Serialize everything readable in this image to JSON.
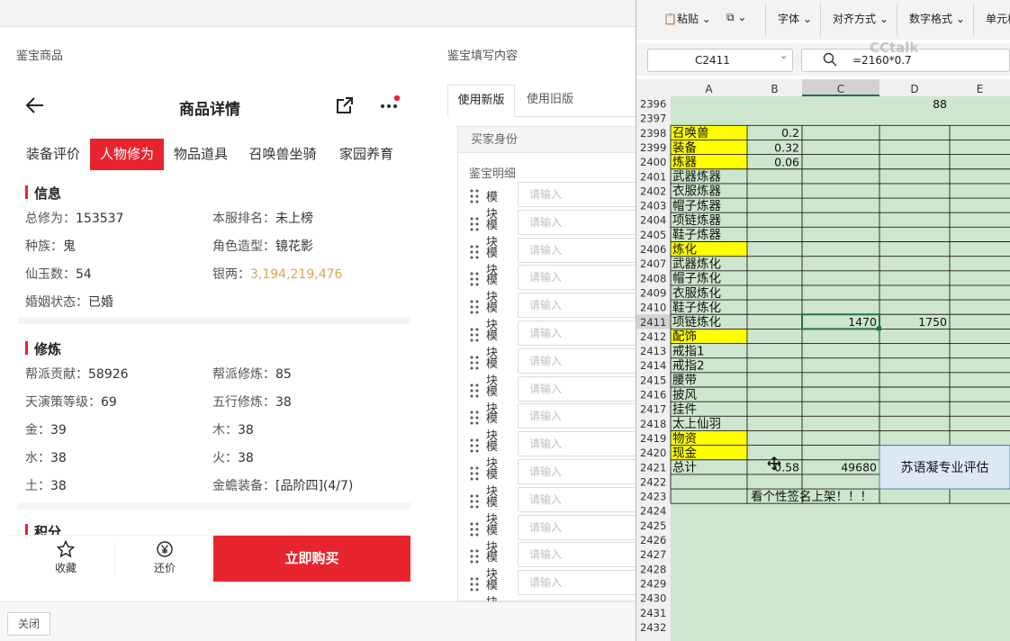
{
  "left_title": "鉴宝商品",
  "right_title": "鉴宝填写内容",
  "close_label": "关闭",
  "phone": {
    "title": "商品详情",
    "tabs": [
      "装备评价",
      "人物修为",
      "物品道具",
      "召唤兽坐骑",
      "家园养育"
    ],
    "active_tab": 1,
    "sections": {
      "info": {
        "title": "信息",
        "rows": [
          [
            {
              "k": "总修为：",
              "v": "153537"
            },
            {
              "k": "本服排名：",
              "v": "未上榜"
            }
          ],
          [
            {
              "k": "种族：",
              "v": "鬼"
            },
            {
              "k": "角色造型：",
              "v": "镜花影"
            }
          ],
          [
            {
              "k": "仙玉数：",
              "v": "54"
            },
            {
              "k": "银两：",
              "v": "3,194,219,476",
              "gold": true
            }
          ],
          [
            {
              "k": "婚姻状态：",
              "v": "已婚"
            }
          ]
        ]
      },
      "train": {
        "title": "修炼",
        "rows": [
          [
            {
              "k": "帮派贡献：",
              "v": "58926"
            },
            {
              "k": "帮派修炼：",
              "v": "85"
            }
          ],
          [
            {
              "k": "天演策等级：",
              "v": "69"
            },
            {
              "k": "五行修炼：",
              "v": "38"
            }
          ],
          [
            {
              "k": "金：",
              "v": "39"
            },
            {
              "k": "木：",
              "v": "38"
            }
          ],
          [
            {
              "k": "水：",
              "v": "38"
            },
            {
              "k": "火：",
              "v": "38"
            }
          ],
          [
            {
              "k": "土：",
              "v": "38"
            },
            {
              "k": "金蟾装备：",
              "v": "[品阶四](4/7)"
            }
          ]
        ]
      },
      "points": {
        "title": "积分"
      }
    },
    "actions": {
      "fav": "收藏",
      "bargain": "还价",
      "buy": "立即购买"
    }
  },
  "form": {
    "tabs": [
      "使用新版",
      "使用旧版"
    ],
    "active_tab": 0,
    "buyer_label": "买家身份",
    "detail_label": "鉴宝明细",
    "row_label": "模块",
    "placeholder": "请输入",
    "row_count": 15
  },
  "excel": {
    "ribbon": {
      "paste": "粘贴",
      "font": "字体",
      "align": "对齐方式",
      "numfmt": "数字格式",
      "cell": "单元格"
    },
    "name_box": "C2411",
    "formula": "=2160*0.7",
    "watermark": "CCtalk",
    "columns": [
      "A",
      "B",
      "C",
      "D",
      "E"
    ],
    "selected_column": "C",
    "selected_row": 2411,
    "rows": [
      {
        "n": 2396,
        "d": "88"
      },
      {
        "n": 2397
      },
      {
        "n": 2398,
        "a": "召唤兽",
        "b": "0.2",
        "hl": true
      },
      {
        "n": 2399,
        "a": "装备",
        "b": "0.32",
        "hl": true
      },
      {
        "n": 2400,
        "a": "炼器",
        "b": "0.06",
        "hl": true
      },
      {
        "n": 2401,
        "a": "武器炼器"
      },
      {
        "n": 2402,
        "a": "衣服炼器"
      },
      {
        "n": 2403,
        "a": "帽子炼器"
      },
      {
        "n": 2404,
        "a": "项链炼器"
      },
      {
        "n": 2405,
        "a": "鞋子炼器"
      },
      {
        "n": 2406,
        "a": "炼化",
        "hl": true
      },
      {
        "n": 2407,
        "a": "武器炼化"
      },
      {
        "n": 2408,
        "a": "帽子炼化"
      },
      {
        "n": 2409,
        "a": "衣服炼化"
      },
      {
        "n": 2410,
        "a": "鞋子炼化"
      },
      {
        "n": 2411,
        "a": "项链炼化",
        "c": "1470",
        "d": "1750"
      },
      {
        "n": 2412,
        "a": "配饰",
        "hl": true
      },
      {
        "n": 2413,
        "a": "戒指1"
      },
      {
        "n": 2414,
        "a": "戒指2"
      },
      {
        "n": 2415,
        "a": "腰带"
      },
      {
        "n": 2416,
        "a": "披风"
      },
      {
        "n": 2417,
        "a": "挂件"
      },
      {
        "n": 2418,
        "a": "太上仙羽"
      },
      {
        "n": 2419,
        "a": "物资",
        "hl": true
      },
      {
        "n": 2420,
        "a": "现金",
        "hl": true
      },
      {
        "n": 2421,
        "a": "总计",
        "b": "0.58",
        "c": "49680"
      },
      {
        "n": 2422
      },
      {
        "n": 2423,
        "b": "看个性签名上架！！！"
      },
      {
        "n": 2424
      },
      {
        "n": 2425
      },
      {
        "n": 2426
      },
      {
        "n": 2427
      },
      {
        "n": 2428
      },
      {
        "n": 2429
      },
      {
        "n": 2430
      },
      {
        "n": 2431
      },
      {
        "n": 2432
      }
    ],
    "textbox": "苏语凝专业评估",
    "colors": {
      "cell": "#cde6cd",
      "grid": "#1e1e1e",
      "highlight": "#ffff00",
      "select": "#217346",
      "textbox": "#dde8f5"
    }
  }
}
